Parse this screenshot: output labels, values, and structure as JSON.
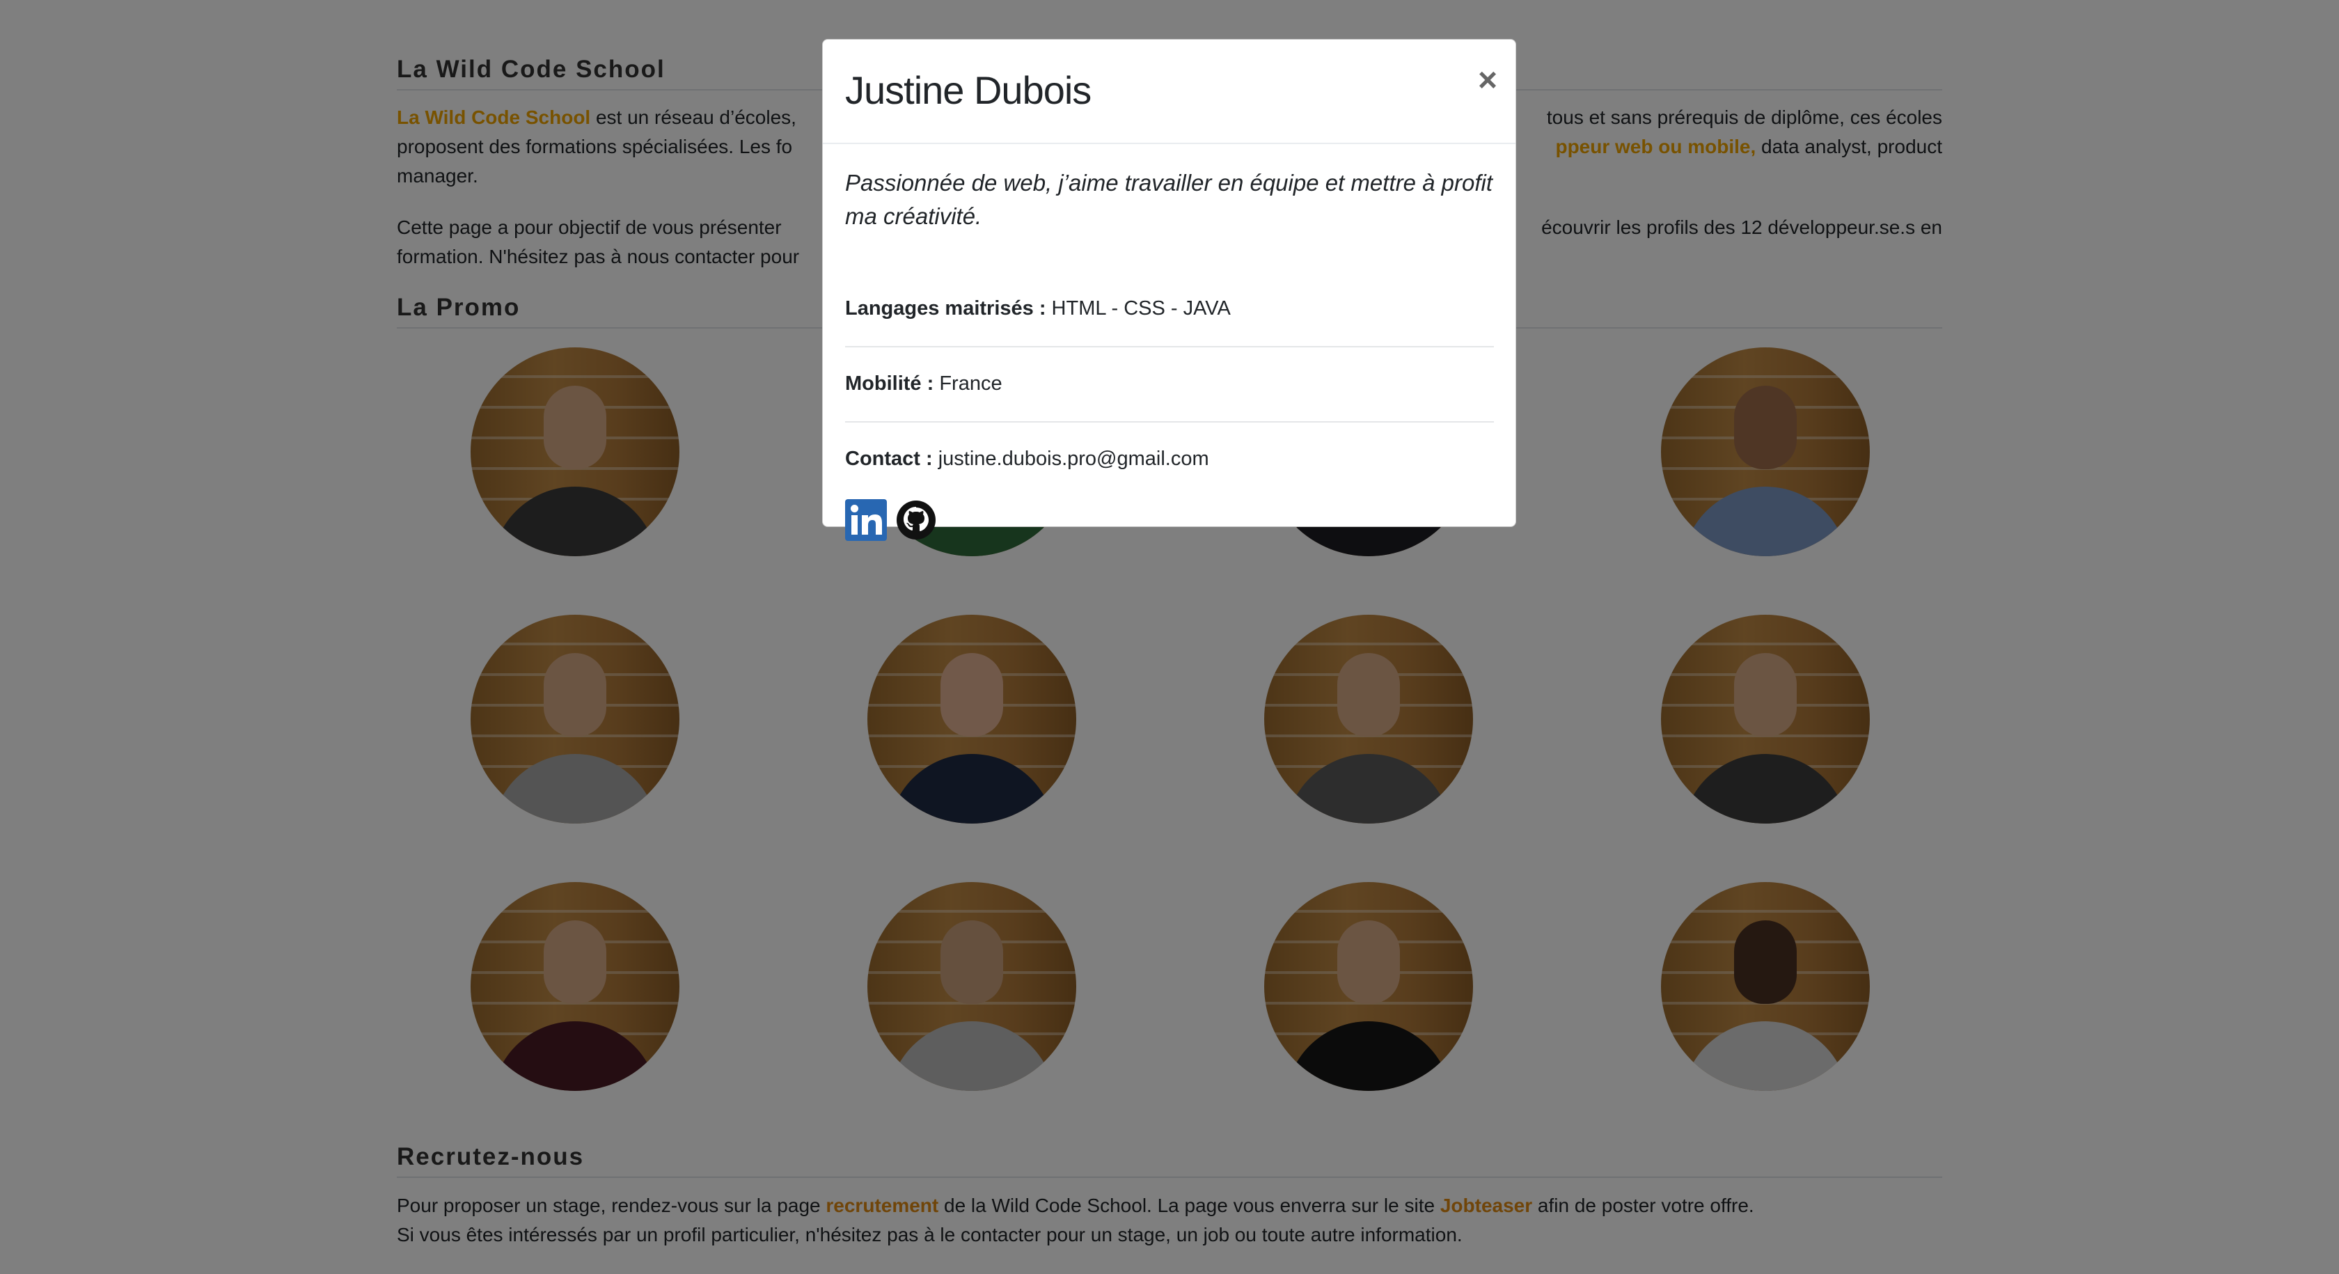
{
  "sections": {
    "about": {
      "title": "La Wild Code School",
      "p1_link": "La Wild Code School",
      "p1_a": " est un réseau d’écoles,",
      "p1_b": "tous et sans prérequis de diplôme, ces écoles",
      "p1_c": "proposent des formations spécialisées. Les fo",
      "p1_d_link": "ppeur web ou mobile,",
      "p1_d": " data analyst, product",
      "p1_e": "manager.",
      "p2_a": "Cette page a pour objectif de vous présenter",
      "p2_b": "écouvrir les profils des 12 développeur.se.s en",
      "p2_c": "formation. N'hésitez pas à nous contacter pour"
    },
    "promo": {
      "title": "La Promo"
    },
    "recruit": {
      "title": "Recrutez-nous",
      "l1_a": "Pour proposer un stage, rendez-vous sur la page ",
      "l1_link1": "recrutement",
      "l1_b": " de la Wild Code School. La page vous enverra sur le site ",
      "l1_link2": "Jobteaser",
      "l1_c": " afin de poster votre offre.",
      "l2": "Si vous êtes intéressés par un profil particulier, n'hésitez pas à le contacter pour un stage, un job ou toute autre information."
    }
  },
  "modal": {
    "name": "Justine Dubois",
    "close_glyph": "×",
    "quote": "Passionnée de web, j’aime travailler en équipe et mettre à profit ma créativité.",
    "languages_label": "Langages maitrisés :",
    "languages_value": " HTML - CSS - JAVA",
    "mobility_label": "Mobilité :",
    "mobility_value": " France",
    "contact_label": "Contact :",
    "contact_value": " justine.dubois.pro@gmail.com",
    "icons": [
      "linkedin-icon",
      "github-icon"
    ]
  },
  "colors": {
    "accent": "#f0a500",
    "linkedin": "#2867b2",
    "overlay": "rgba(0,0,0,0.5)"
  }
}
